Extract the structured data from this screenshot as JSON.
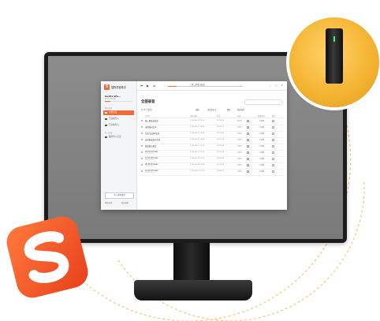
{
  "colors": {
    "accent": "#ef6a3a",
    "badge": "#f5b534",
    "monitor": "#1c1c1c"
  },
  "app": {
    "logo_char": "S",
    "name": "搜狗录音助手",
    "user": "Vestia Wu...",
    "quota": "3.41 / 20 GB",
    "storage_fraction": 0.2,
    "section_1": "我的录音",
    "nav": [
      {
        "label": "全部录音",
        "active": true,
        "icon": "folder-icon"
      },
      {
        "label": "已完成导入",
        "active": false,
        "icon": "check-icon"
      },
      {
        "label": "已平板导入",
        "active": false,
        "icon": "tablet-icon"
      }
    ],
    "section_2": "导入记录",
    "nav_extra": {
      "label": "我的导入记录",
      "icon": "history-icon"
    },
    "import_button": "导入本地录音",
    "footer_left": "帮助反馈",
    "footer_right": "检查更新"
  },
  "player": {
    "prev_icon": "⏮",
    "play_icon": "▶",
    "next_icon": "⏭",
    "now_playing": "第二季度总结会",
    "progress_fraction": 0.12,
    "window_controls": "— ▢ ✕"
  },
  "main": {
    "title": "全部录音",
    "count": "共 8 个录音",
    "tools": [
      "编辑",
      "语音转文字",
      "删除",
      "更多操作"
    ],
    "columns": [
      "文件名",
      "录音日期",
      "时长",
      "状态",
      "",
      "编辑状态",
      "操作"
    ],
    "rows": [
      {
        "name": "第二季度总结会",
        "sub": "2019.06.18",
        "date": "2019.06.18 10:32",
        "dur": "01:03:20",
        "status": "转写中",
        "edit": "已编辑"
      },
      {
        "name": "市场研讨会 2",
        "sub": "2019.06.17",
        "date": "2019.06.17 14:20",
        "dur": "00:40:11",
        "status": "已转写",
        "edit": "未编辑"
      },
      {
        "name": "5月产品评审会议",
        "sub": "2019.06.15",
        "date": "2019.06.15 09:05",
        "dur": "00:52:40",
        "status": "已转写",
        "edit": "未编辑"
      },
      {
        "name": "讨论新品发布文案",
        "sub": "2019.06.14",
        "date": "2019.06.14 16:45",
        "dur": "00:25:18",
        "status": "已转写",
        "edit": "已编辑"
      },
      {
        "name": "周总结汇报会",
        "sub": "2019.06.12",
        "date": "2019.06.12 11:10",
        "dur": "00:33:52",
        "status": "已转写",
        "edit": "未编辑"
      },
      {
        "name": "23-10-10.wav",
        "sub": "2019.06.10",
        "date": "2019.06.10 23:10",
        "dur": "00:12:05",
        "status": "未转写",
        "edit": "未编辑"
      },
      {
        "name": "12-10-55.wav",
        "sub": "2019.06.09",
        "date": "2019.06.09 12:10",
        "dur": "00:08:47",
        "status": "未转写",
        "edit": "未编辑"
      },
      {
        "name": "20-50-34.wav",
        "sub": "2019.06.08",
        "date": "2019.06.08 20:50",
        "dur": "00:15:30",
        "status": "未转写",
        "edit": "未编辑"
      },
      {
        "name": "21-10-15.wav",
        "sub": "2019.06.07",
        "date": "2019.06.07 21:10",
        "dur": "00:06:22",
        "status": "未转写",
        "edit": "未编辑"
      }
    ]
  },
  "icons": {
    "badge_device": "recorder-device-icon",
    "brand": "sogou-logo-icon"
  }
}
